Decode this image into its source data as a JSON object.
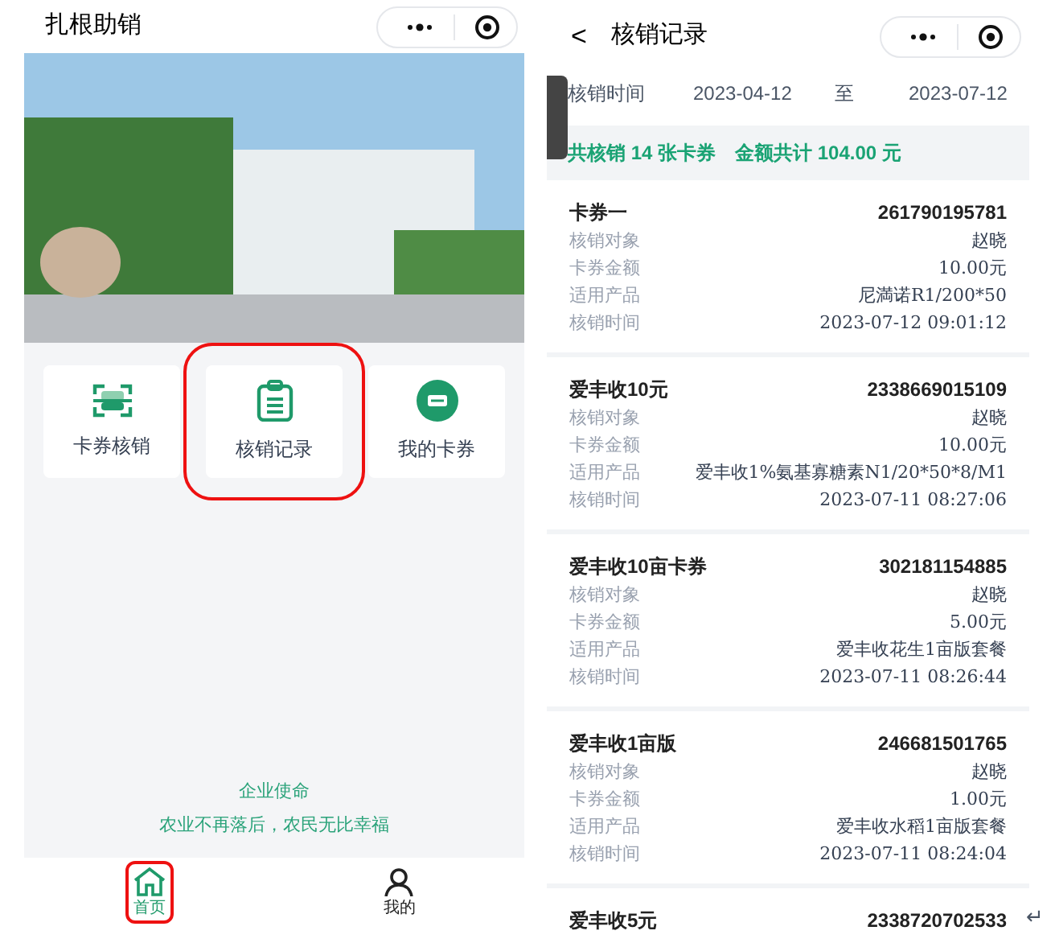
{
  "home": {
    "title": "扎根助销",
    "menu": [
      {
        "kind": "scan",
        "label": "卡券核销",
        "annotated": false
      },
      {
        "kind": "clipboard",
        "label": "核销记录",
        "annotated": true
      },
      {
        "kind": "ticket",
        "label": "我的卡券",
        "annotated": false
      }
    ],
    "mission": {
      "heading": "企业使命",
      "text": "农业不再落后，农民无比幸福"
    },
    "tabs": [
      {
        "kind": "home",
        "label": "首页",
        "selected": true,
        "annotated": true
      },
      {
        "kind": "user",
        "label": "我的",
        "selected": false,
        "annotated": false
      }
    ]
  },
  "records_page": {
    "back": "<",
    "title": "核销记录",
    "filter": {
      "label": "核销时间",
      "from": "2023-04-12",
      "separator": "至",
      "to": "2023-07-12"
    },
    "summary": {
      "count": "共核销 14 张卡券",
      "amount": "金额共计 104.00 元"
    },
    "records": [
      {
        "name": "卡券一",
        "code": "261790195781",
        "fields": [
          {
            "label": "核销对象",
            "value": "赵晓"
          },
          {
            "label": "卡券金额",
            "value": "10.00元"
          },
          {
            "label": "适用产品",
            "value": "尼満诺R1/200*50"
          },
          {
            "label": "核销时间",
            "value": "2023-07-12 09:01:12"
          }
        ]
      },
      {
        "name": "爱丰收10元",
        "code": "2338669015109",
        "fields": [
          {
            "label": "核销对象",
            "value": "赵晓"
          },
          {
            "label": "卡券金额",
            "value": "10.00元"
          },
          {
            "label": "适用产品",
            "value": "爱丰收1%氨基寡糖素N1/20*50*8/M1"
          },
          {
            "label": "核销时间",
            "value": "2023-07-11 08:27:06"
          }
        ]
      },
      {
        "name": "爱丰收10亩卡券",
        "code": "302181154885",
        "fields": [
          {
            "label": "核销对象",
            "value": "赵晓"
          },
          {
            "label": "卡券金额",
            "value": "5.00元"
          },
          {
            "label": "适用产品",
            "value": "爱丰收花生1亩版套餐"
          },
          {
            "label": "核销时间",
            "value": "2023-07-11 08:26:44"
          }
        ]
      },
      {
        "name": "爱丰收1亩版",
        "code": "246681501765",
        "fields": [
          {
            "label": "核销对象",
            "value": "赵晓"
          },
          {
            "label": "卡券金额",
            "value": "1.00元"
          },
          {
            "label": "适用产品",
            "value": "爱丰收水稻1亩版套餐"
          },
          {
            "label": "核销时间",
            "value": "2023-07-11 08:24:04"
          }
        ]
      },
      {
        "name": "爱丰收5元",
        "code": "2338720702533"
      }
    ]
  },
  "return_mark": "↵"
}
